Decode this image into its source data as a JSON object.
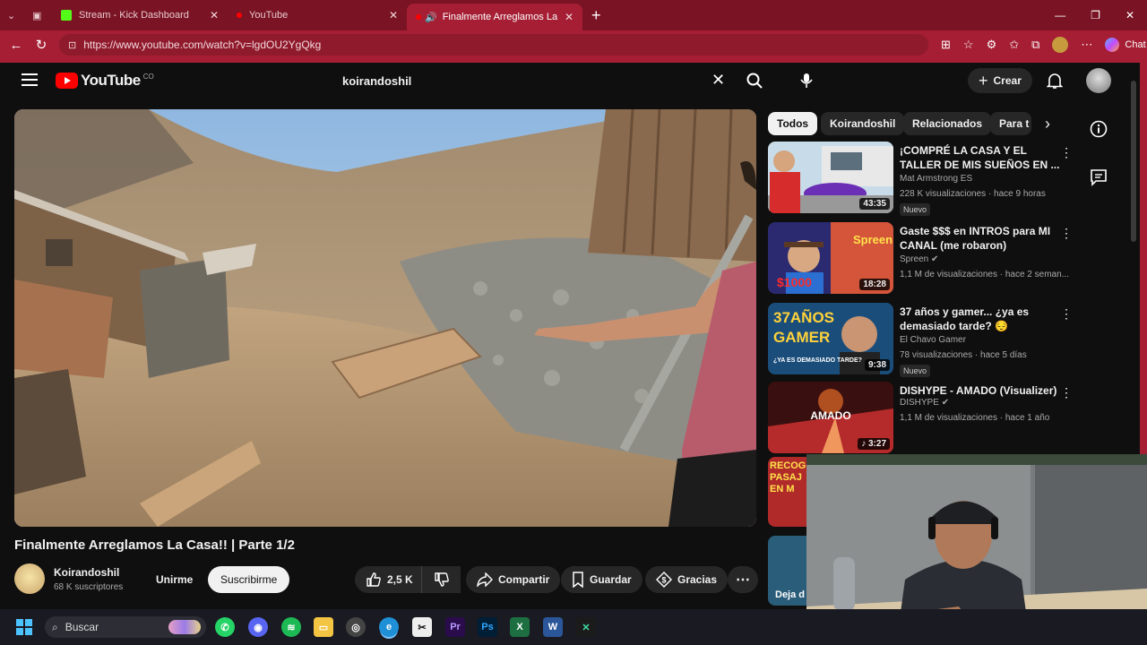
{
  "browser": {
    "tabs": [
      {
        "label": "Stream - Kick Dashboard",
        "color": "#53fc18"
      },
      {
        "label": "YouTube",
        "color": "#ff0000"
      },
      {
        "label": "Finalmente Arreglamos La Cas",
        "color": "#ff0000"
      }
    ],
    "url": "https://www.youtube.com/watch?v=lgdOU2YgQkg",
    "chat_label": "Chat",
    "accent": "#a51e33"
  },
  "youtube": {
    "logo_text": "YouTube",
    "country_code": "CO",
    "search_value": "koirandoshil",
    "create_label": "Crear"
  },
  "video": {
    "title": "Finalmente Arreglamos La Casa!! | Parte 1/2",
    "channel": "Koirandoshil",
    "subscribers": "68 K suscriptores",
    "join_label": "Unirme",
    "subscribe_label": "Suscribirme",
    "likes": "2,5 K",
    "share_label": "Compartir",
    "save_label": "Guardar",
    "thanks_label": "Gracias"
  },
  "chips": [
    "Todos",
    "Koirandoshil",
    "Relacionados",
    "Para t"
  ],
  "recommendations": [
    {
      "title": "¡COMPRÉ LA CASA Y EL TALLER DE MIS SUEÑOS EN ...",
      "channel": "Mat Armstrong ES",
      "meta": "228 K visualizaciones · hace 9 horas",
      "duration": "43:35",
      "badge": "Nuevo"
    },
    {
      "title": "Gaste $$$ en INTROS para MI CANAL (me robaron)",
      "channel": "Spreen",
      "meta": "1,1 M de visualizaciones · hace 2 seman...",
      "duration": "18:28",
      "badge": ""
    },
    {
      "title": "37 años y gamer... ¿ya es demasiado tarde? 😔",
      "channel": "El Chavo Gamer",
      "meta": "78 visualizaciones · hace 5 días",
      "duration": "9:38",
      "badge": "Nuevo"
    },
    {
      "title": "DISHYPE - AMADO (Visualizer)",
      "channel": "DISHYPE",
      "meta": "1,1 M de visualizaciones · hace 1 año",
      "duration": "3:27",
      "badge": ""
    }
  ],
  "thumb_text": {
    "r1": "$1000",
    "r2_line1": "37AÑOS",
    "r2_line2": "GAMER",
    "r2_sub": "¿YA ES DEMASIADO TARDE?",
    "r3": "AMADO",
    "r4a": "RECOGI",
    "r4b": "PASAJ",
    "r4c": "EN M"
  },
  "partial_rec_text": "Deja d",
  "taskbar": {
    "search_label": "Buscar"
  }
}
